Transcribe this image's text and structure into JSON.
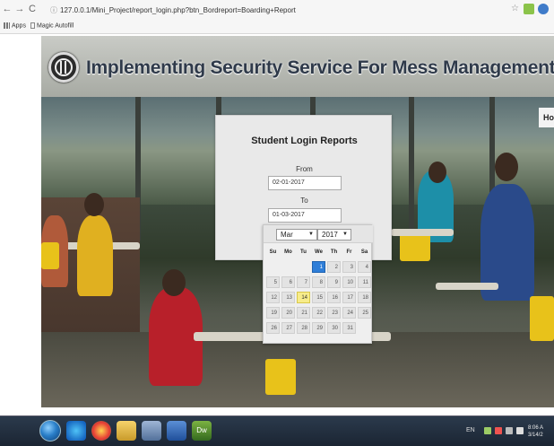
{
  "browser": {
    "url": "127.0.0.1/Mini_Project/report_login.php?btn_Bordreport=Boarding+Report",
    "bookmarks": [
      "Apps",
      "Magic Autofill"
    ]
  },
  "site": {
    "title": "Implementing Security Service For Mess Management System Using PHP.",
    "nav_home": "Hon"
  },
  "report": {
    "title": "Student Login Reports",
    "from_label": "From",
    "from_value": "02-01-2017",
    "to_label": "To",
    "to_value": "01-03-2017"
  },
  "datepicker": {
    "month": "Mar",
    "year": "2017",
    "weekdays": [
      "Su",
      "Mo",
      "Tu",
      "We",
      "Th",
      "Fr",
      "Sa"
    ],
    "first_weekday_index": 3,
    "days_in_month": 31,
    "selected_day": 1,
    "today_day": 14
  },
  "taskbar": {
    "lang": "EN",
    "clock_time": "8:06 A",
    "clock_date": "3/14/2"
  }
}
